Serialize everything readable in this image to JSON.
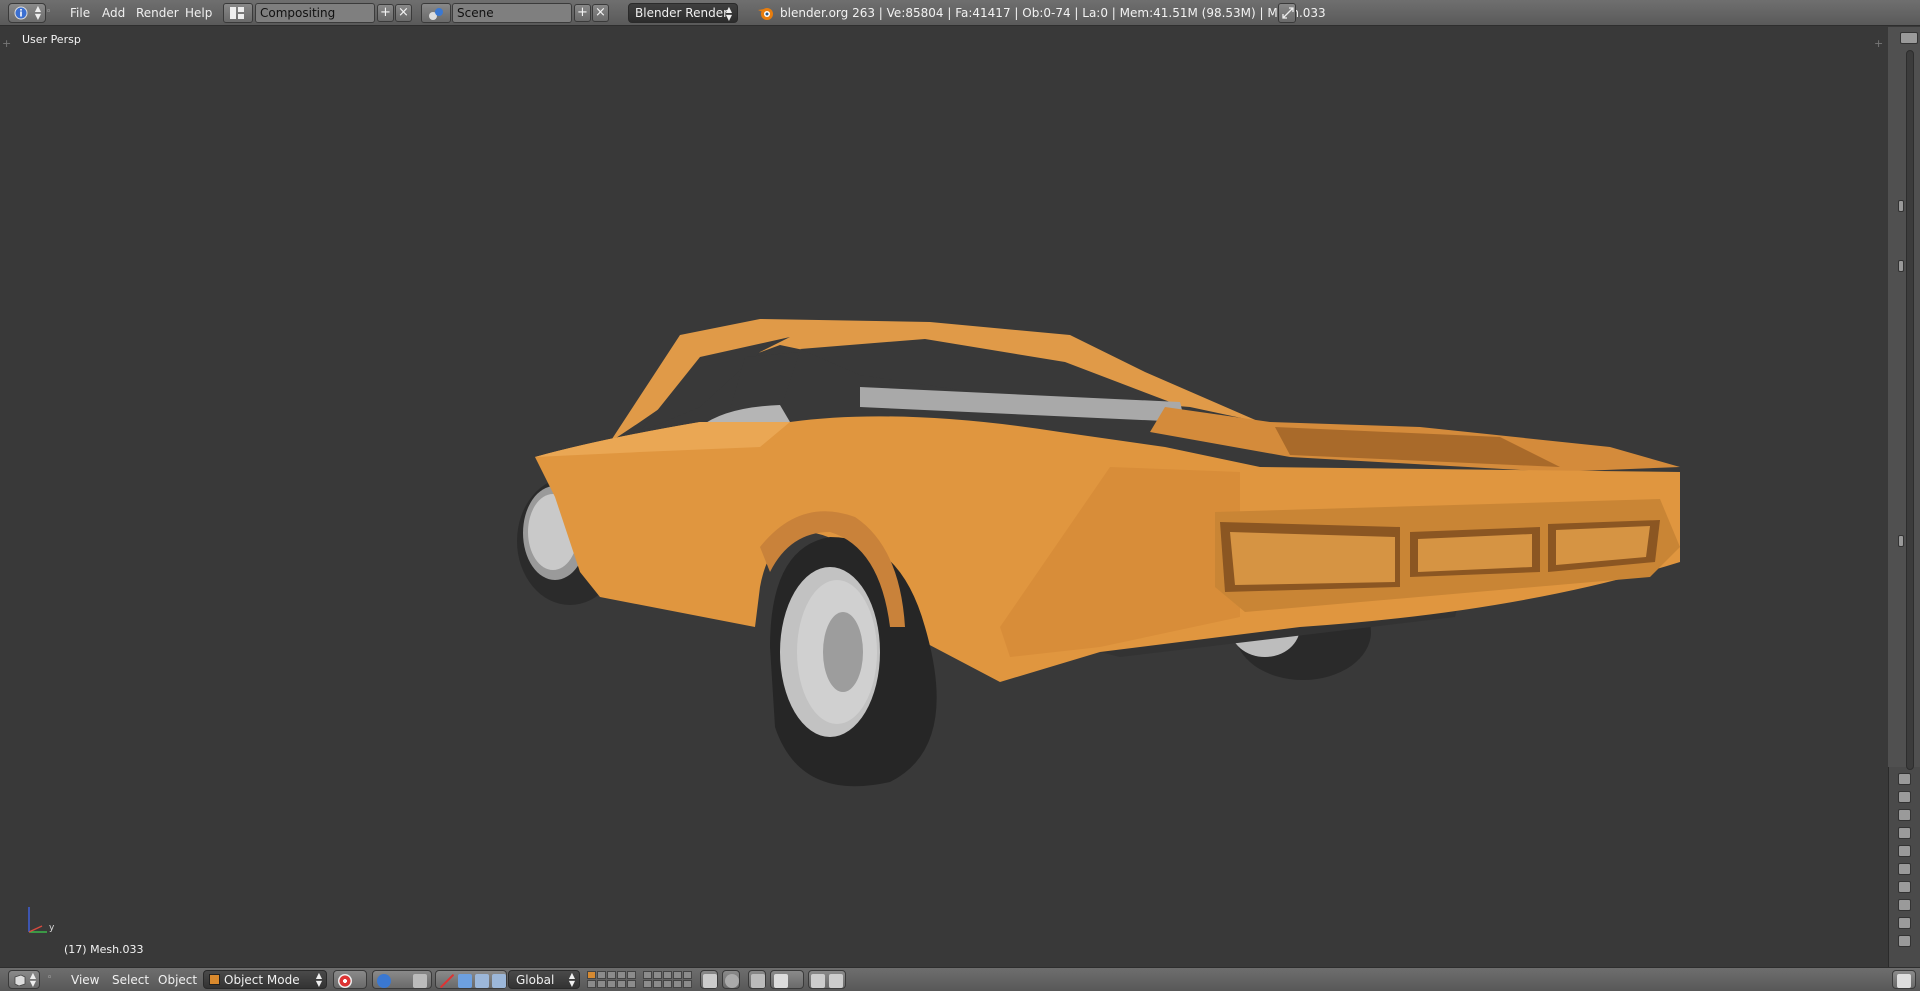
{
  "top_header": {
    "menus": [
      "File",
      "Add",
      "Render",
      "Help"
    ],
    "screen_layout": "Compositing",
    "scene": "Scene",
    "render_engine": "Blender Render",
    "stats": "blender.org 263 | Ve:85804 | Fa:41417 | Ob:0-74 | La:0 | Mem:41.51M (98.53M) | Mesh.033"
  },
  "viewport": {
    "view_label": "User Persp",
    "object_info": "(17) Mesh.033",
    "axis_y_label": "y",
    "object_color": "#e0963f",
    "background_color": "#393939"
  },
  "bottom_header": {
    "menus": [
      "View",
      "Select",
      "Object"
    ],
    "mode": "Object Mode",
    "orientation": "Global"
  },
  "icons": {
    "info_editor": "info-icon",
    "layout": "layout-icon",
    "scene": "scene-icon",
    "blender": "blender-logo-icon",
    "maximize": "maximize-icon"
  }
}
